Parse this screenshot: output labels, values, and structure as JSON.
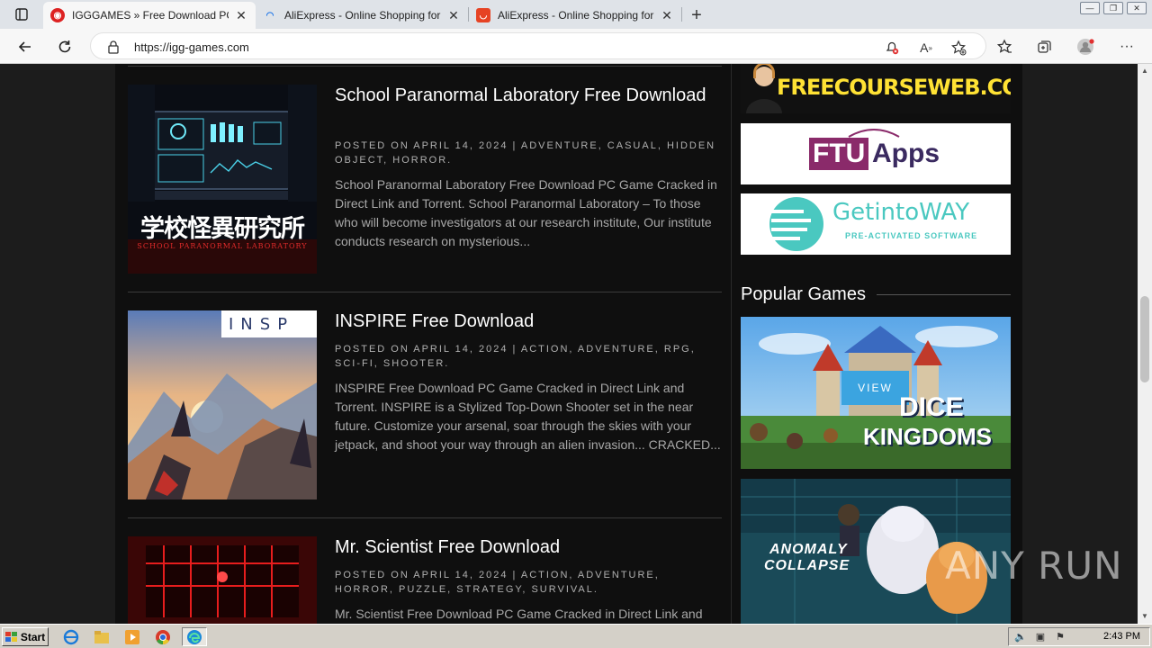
{
  "browser": {
    "tabs": [
      {
        "label": "IGGGAMES » Free Download PC G",
        "active": true
      },
      {
        "label": "AliExpress - Online Shopping for",
        "active": false
      },
      {
        "label": "AliExpress - Online Shopping for",
        "active": false
      }
    ],
    "url": "https://igg-games.com"
  },
  "posts": [
    {
      "title": "School Paranormal Laboratory Free Download",
      "meta": "POSTED ON APRIL 14, 2024 | ADVENTURE, CASUAL, HIDDEN OBJECT, HORROR.",
      "excerpt": "School Paranormal Laboratory Free Download PC Game Cracked in Direct Link and Torrent. School Paranormal Laboratory – To those who will become investigators at our research institute, Our institute conducts research on mysterious...",
      "thumb_text": "学校怪異研究所",
      "thumb_subtext": "SCHOOL PARANORMAL LABORATORY"
    },
    {
      "title": "INSPIRE Free Download",
      "meta": "POSTED ON APRIL 14, 2024 | ACTION, ADVENTURE, RPG, SCI-FI, SHOOTER.",
      "excerpt": "INSPIRE Free Download PC Game Cracked in Direct Link and Torrent. INSPIRE is a Stylized Top-Down Shooter set in the near future. Customize your arsenal, soar through the skies with your jetpack, and shoot your way through an alien invasion... CRACKED...",
      "thumb_text": "INSP"
    },
    {
      "title": "Mr. Scientist Free Download",
      "meta": "POSTED ON APRIL 14, 2024 | ACTION, ADVENTURE, HORROR, PUZZLE, STRATEGY, SURVIVAL.",
      "excerpt": "Mr. Scientist Free Download PC Game Cracked in Direct Link and"
    }
  ],
  "sidebar": {
    "ads": [
      {
        "text": "FREECOURSEWEB.COM"
      },
      {
        "text_a": "FTU",
        "text_b": "Apps"
      },
      {
        "text": "GetintoWAY",
        "sub": "PRE-ACTIVATED SOFTWARE"
      }
    ],
    "popular_title": "Popular Games",
    "games": [
      {
        "title_a": "DICE",
        "title_b": "KINGDOMS",
        "button": "VIEW"
      },
      {
        "title_a": "ANOMALY",
        "title_b": "COLLAPSE"
      }
    ]
  },
  "watermark": "ANY RUN",
  "taskbar": {
    "start_label": "Start",
    "clock": "2:43 PM"
  },
  "colors": {
    "accent": "#3ba4e0",
    "background": "#0f0f0f"
  }
}
